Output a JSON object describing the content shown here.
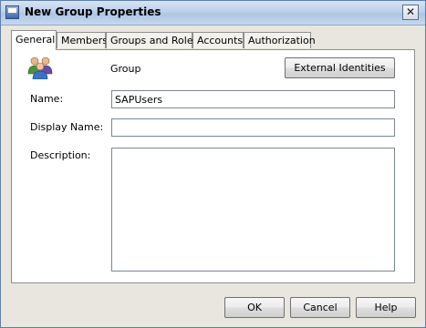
{
  "window": {
    "title": "New Group Properties",
    "close_label": "✕"
  },
  "tabs": [
    {
      "label": "General",
      "active": true
    },
    {
      "label": "Members"
    },
    {
      "label": "Groups and Roles"
    },
    {
      "label": "Accounts"
    },
    {
      "label": "Authorization"
    }
  ],
  "general": {
    "type_label": "Group",
    "external_identities_label": "External Identities",
    "name_label": "Name:",
    "name_value": "SAPUsers",
    "display_name_label": "Display Name:",
    "display_name_value": "",
    "description_label": "Description:",
    "description_value": ""
  },
  "footer": {
    "ok_label": "OK",
    "cancel_label": "Cancel",
    "help_label": "Help"
  },
  "icons": {
    "app": "window-icon",
    "group": "group-users-icon"
  }
}
